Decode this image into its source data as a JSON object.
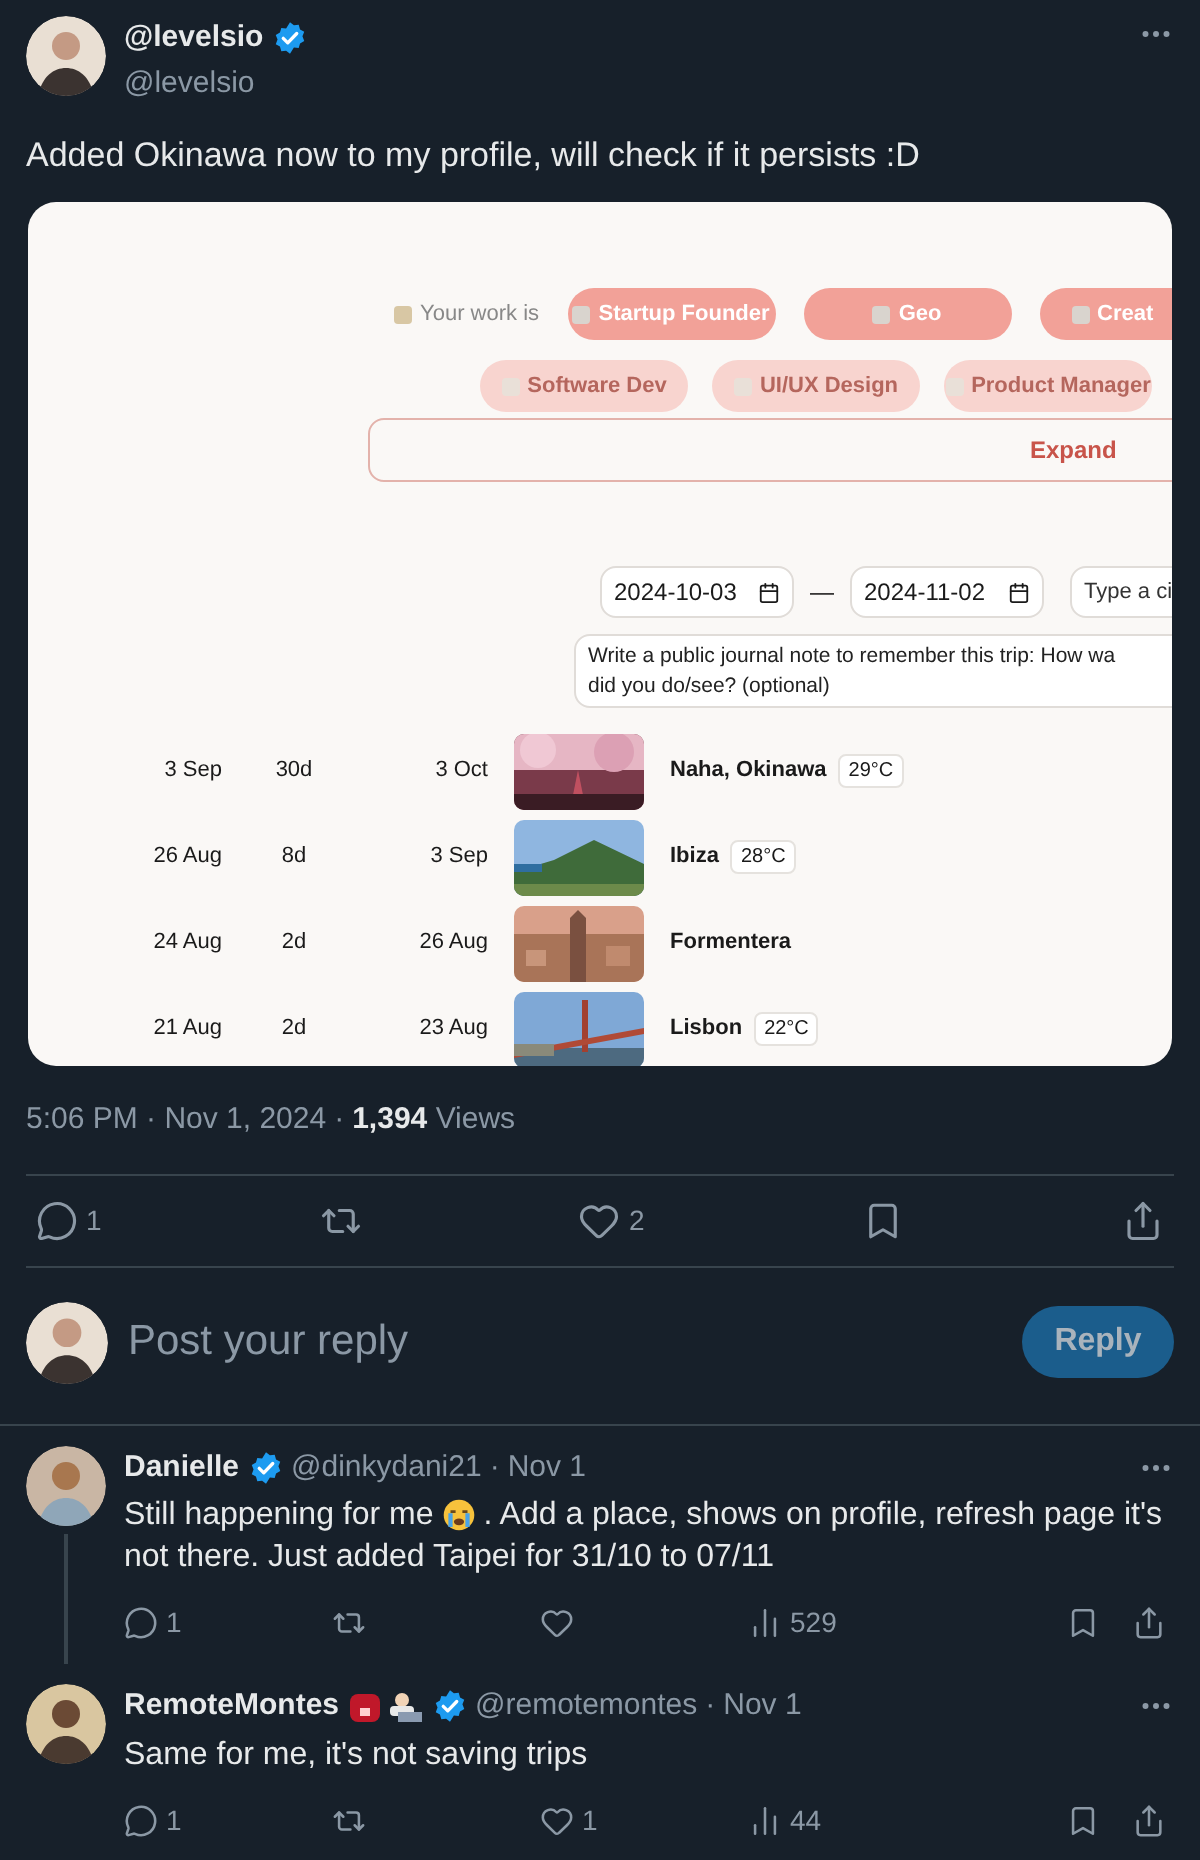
{
  "tweet": {
    "author_name": "@levelsio",
    "handle": "@levelsio",
    "verified": true,
    "text": "Added Okinawa now to my profile, will check if it persists :D"
  },
  "embedded_screenshot": {
    "work_label": "Your work is",
    "chip_rows": [
      {
        "faded": false,
        "chips": [
          "Startup Founder",
          "Geo",
          "Creat"
        ]
      },
      {
        "faded": true,
        "chips": [
          "Software Dev",
          "UI/UX Design",
          "Product Manager"
        ]
      }
    ],
    "expand_button": "Expand",
    "start_date": "2024-10-03",
    "date_separator": "—",
    "end_date": "2024-11-02",
    "city_placeholder": "Type a ci",
    "journal_placeholder_lines": [
      "Write a public journal note to remember this trip: How wa",
      "did you do/see? (optional)"
    ],
    "trips": [
      {
        "start": "3 Sep",
        "duration": "30d",
        "end": "3 Oct",
        "place": "Naha, Okinawa",
        "temperature": "29°C"
      },
      {
        "start": "26 Aug",
        "duration": "8d",
        "end": "3 Sep",
        "place": "Ibiza",
        "temperature": "28°C"
      },
      {
        "start": "24 Aug",
        "duration": "2d",
        "end": "26 Aug",
        "place": "Formentera"
      },
      {
        "start": "21 Aug",
        "duration": "2d",
        "end": "23 Aug",
        "place": "Lisbon",
        "temperature": "22°C"
      }
    ]
  },
  "meta": {
    "timestamp": "5:06 PM · Nov 1, 2024",
    "separator": "·",
    "views_count": "1,394",
    "views_label": "Views"
  },
  "actions": [
    {
      "kind": "reply",
      "count": "1"
    },
    {
      "kind": "repost"
    },
    {
      "kind": "like",
      "count": "2"
    },
    {
      "kind": "bookmark"
    },
    {
      "kind": "share"
    }
  ],
  "reply_box": {
    "placeholder": "Post your reply",
    "button": "Reply"
  },
  "replies": [
    {
      "name": "Danielle",
      "verified": true,
      "handle": "@dinkydani21",
      "separator": "·",
      "date": "Nov 1",
      "text_lines": [
        [
          "Still happening for me",
          ". Add a place, shows on profile, refresh page it's"
        ],
        [
          "not there. Just added Taipei for 31/10 to 07/11"
        ]
      ],
      "thread_line": true,
      "name_emojis": false,
      "actions": [
        {
          "kind": "reply",
          "count": "1"
        },
        {
          "kind": "repost"
        },
        {
          "kind": "like"
        },
        {
          "kind": "views",
          "count": "529"
        },
        {
          "kind": "bookmark"
        },
        {
          "kind": "share"
        }
      ]
    },
    {
      "name": "RemoteMontes",
      "verified": true,
      "handle": "@remotemontes",
      "separator": "·",
      "date": "Nov 1",
      "text_lines": [
        [
          "Same for me, it's not saving trips"
        ]
      ],
      "thread_line": false,
      "name_emojis": true,
      "actions": [
        {
          "kind": "reply",
          "count": "1"
        },
        {
          "kind": "repost"
        },
        {
          "kind": "like",
          "count": "1"
        },
        {
          "kind": "views",
          "count": "44"
        },
        {
          "kind": "bookmark"
        },
        {
          "kind": "share"
        }
      ]
    }
  ]
}
